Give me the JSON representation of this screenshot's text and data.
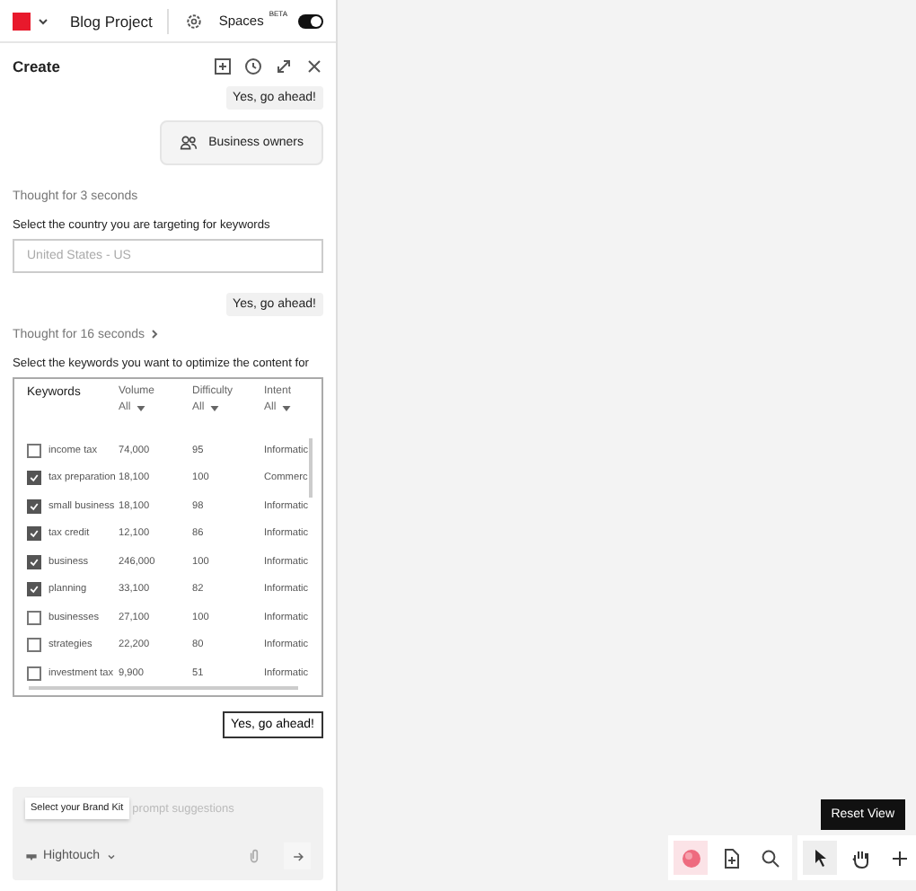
{
  "header": {
    "project": "Blog Project",
    "spaces": "Spaces",
    "badge": "BETA",
    "spaces_on": true
  },
  "panel": {
    "title": "Create"
  },
  "messages": [
    {
      "kind": "user",
      "text": "Yes, go ahead!"
    },
    {
      "kind": "chip",
      "text": "Business owners"
    },
    {
      "kind": "thought",
      "text": "Thought for 3 seconds",
      "expandable": false
    },
    {
      "kind": "prompt",
      "text": "Select the country you are targeting for keywords"
    },
    {
      "kind": "field",
      "placeholder": "United States - US"
    },
    {
      "kind": "user",
      "text": "Yes, go ahead!"
    },
    {
      "kind": "thought",
      "text": "Thought for 16 seconds",
      "expandable": true
    },
    {
      "kind": "prompt",
      "text": "Select the keywords you want to optimize the content for"
    },
    {
      "kind": "table",
      "columns": [
        {
          "label": "Keywords"
        },
        {
          "label": "Volume",
          "filter": "All"
        },
        {
          "label": "Difficulty",
          "filter": "All"
        },
        {
          "label": "Intent",
          "filter": "All"
        }
      ],
      "rows": [
        {
          "keyword": "income tax",
          "volume": "74,000",
          "difficulty": "95",
          "intent": "Informatic",
          "checked": false
        },
        {
          "keyword": "tax preparation",
          "volume": "18,100",
          "difficulty": "100",
          "intent": "Commerc",
          "checked": true
        },
        {
          "keyword": "small business",
          "volume": "18,100",
          "difficulty": "98",
          "intent": "Informatic",
          "checked": true
        },
        {
          "keyword": "tax credit",
          "volume": "12,100",
          "difficulty": "86",
          "intent": "Informatic",
          "checked": true
        },
        {
          "keyword": "business",
          "volume": "246,000",
          "difficulty": "100",
          "intent": "Informatic",
          "checked": true
        },
        {
          "keyword": "planning",
          "volume": "33,100",
          "difficulty": "82",
          "intent": "Informatic",
          "checked": true
        },
        {
          "keyword": "businesses",
          "volume": "27,100",
          "difficulty": "100",
          "intent": "Informatic",
          "checked": false
        },
        {
          "keyword": "strategies",
          "volume": "22,200",
          "difficulty": "80",
          "intent": "Informatic",
          "checked": false
        },
        {
          "keyword": "investment tax",
          "volume": "9,900",
          "difficulty": "51",
          "intent": "Informatic",
          "checked": false
        }
      ]
    },
    {
      "kind": "button",
      "text": "Yes, go ahead!"
    }
  ],
  "composer": {
    "placeholder": "prompt suggestions",
    "tooltip": "Select your Brand Kit",
    "brand": "Hightouch"
  },
  "canvas": {
    "tooltip": "Reset View",
    "tools": [
      {
        "kind": "avatar",
        "selected": true
      },
      {
        "kind": "add-page",
        "selected": false
      },
      {
        "kind": "search",
        "selected": false
      }
    ],
    "modes": [
      {
        "kind": "pointer",
        "selected": true
      },
      {
        "kind": "hand",
        "selected": false
      },
      {
        "kind": "plus",
        "selected": false
      }
    ]
  }
}
